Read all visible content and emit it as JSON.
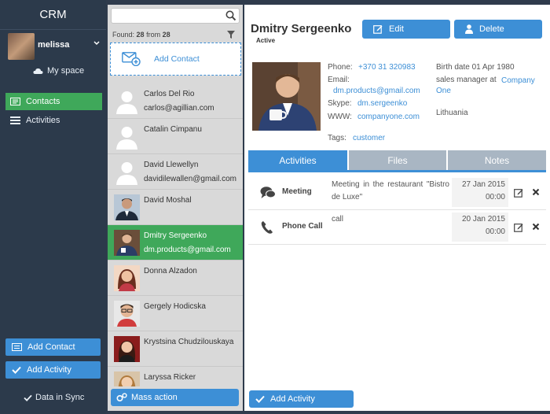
{
  "app": {
    "title": "CRM"
  },
  "user": {
    "name": "melissa"
  },
  "sidebar": {
    "myspace": "My space",
    "items": [
      {
        "label": "Contacts",
        "active": true
      },
      {
        "label": "Activities",
        "active": false
      }
    ],
    "add_contact": "Add Contact",
    "add_activity": "Add Activity",
    "sync": "Data in Sync"
  },
  "list": {
    "search_placeholder": "",
    "found_prefix": "Found:",
    "found_count": "28",
    "found_mid": "from",
    "found_total": "28",
    "add_contact": "Add Contact",
    "mass_action": "Mass action",
    "contacts": [
      {
        "name": "Carlos Del Rio",
        "email": "carlos@agillian.com",
        "photo": "placeholder"
      },
      {
        "name": "Catalin Cimpanu",
        "email": "",
        "photo": "placeholder"
      },
      {
        "name": "David Llewellyn",
        "email": "davidilewallen@gmail.com",
        "photo": "placeholder"
      },
      {
        "name": "David Moshal",
        "email": "",
        "photo": "man-suit"
      },
      {
        "name": "Dmitry Sergeenko",
        "email": "dm.products@gmail.com",
        "photo": "man-cup",
        "active": true
      },
      {
        "name": "Donna Alzadon",
        "email": "",
        "photo": "woman"
      },
      {
        "name": "Gergely Hodicska",
        "email": "",
        "photo": "man-glasses"
      },
      {
        "name": "Krystsina Chudzilouskaya",
        "email": "",
        "photo": "woman2"
      },
      {
        "name": "Laryssa Ricker",
        "email": "",
        "photo": "woman3"
      }
    ]
  },
  "detail": {
    "name": "Dmitry Sergeenko",
    "status": "Active",
    "edit": "Edit",
    "delete": "Delete",
    "phone_label": "Phone:",
    "phone": "+370 31 320983",
    "email_label": "Email:",
    "email": "dm.products@gmail.com",
    "skype_label": "Skype:",
    "skype": "dm.sergeenko",
    "www_label": "WWW:",
    "www": "companyone.com",
    "tags_label": "Tags:",
    "tags": "customer",
    "birth": "Birth date 01 Apr 1980",
    "position": "sales manager at",
    "company": "Company One",
    "country": "Lithuania",
    "tabs": [
      "Activities",
      "Files",
      "Notes"
    ],
    "activities": [
      {
        "type": "Meeting",
        "icon": "chat-icon",
        "desc": "Meeting in the restaurant \"Bistro de Luxe\"",
        "date": "27 Jan 2015",
        "time": "00:00"
      },
      {
        "type": "Phone Call",
        "icon": "phone-icon",
        "desc": "call",
        "date": "20 Jan 2015",
        "time": "00:00"
      }
    ],
    "add_activity": "Add Activity"
  },
  "colors": {
    "accent": "#3d8fd6",
    "active_green": "#3fa85a",
    "sidebar_bg": "#2c3a4b"
  }
}
